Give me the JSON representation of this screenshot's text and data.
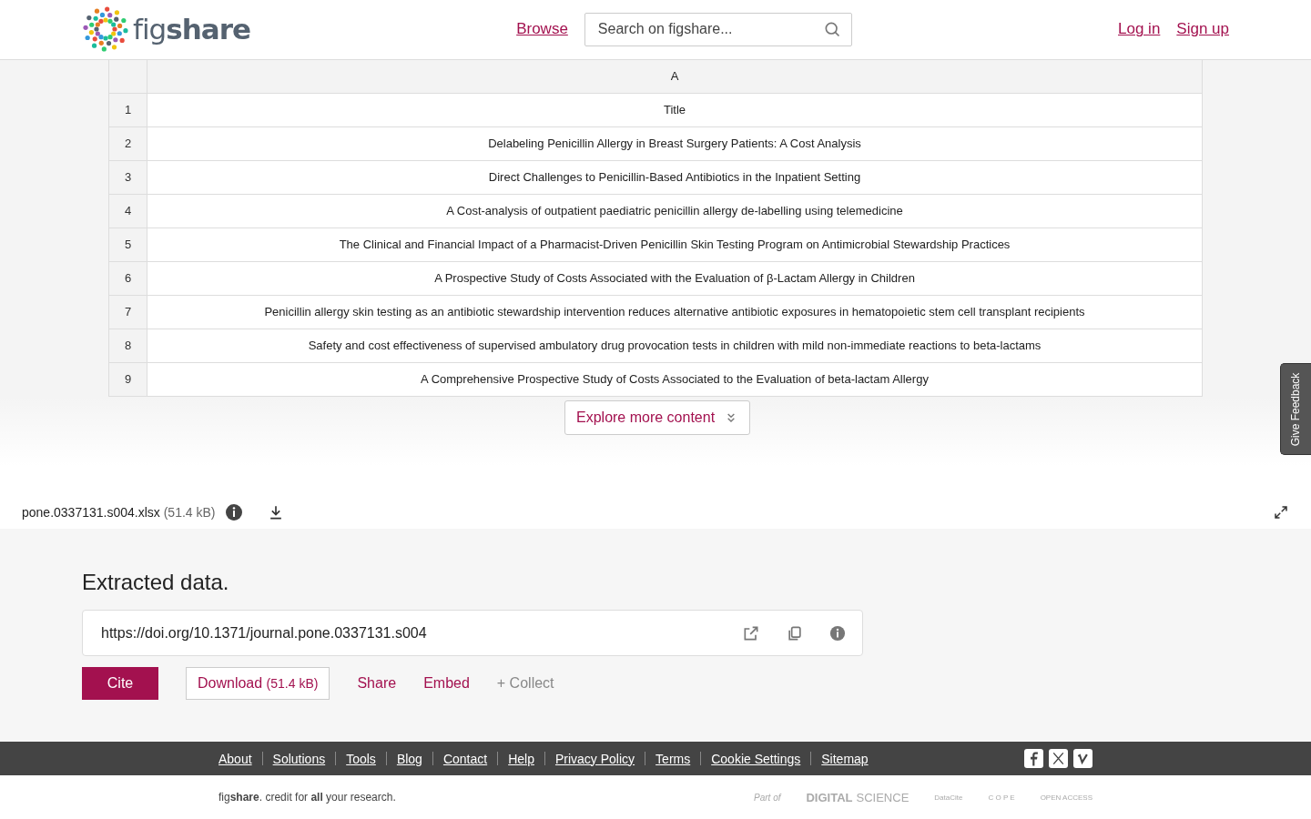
{
  "header": {
    "logo": "fig**share**",
    "nav": [
      {
        "label": "Browse"
      }
    ],
    "search": {
      "placeholder": "Search on figshare..."
    },
    "auth": [
      {
        "label": "Log in"
      },
      {
        "label": "Sign up"
      }
    ]
  },
  "sheet": {
    "column": "A",
    "rows": [
      {
        "number": "1",
        "text": "Title"
      },
      {
        "number": "2",
        "text": "Delabeling Penicillin Allergy in Breast Surgery Patients: A Cost Analysis"
      },
      {
        "number": "3",
        "text": "Direct Challenges to Penicillin-Based Antibiotics in the Inpatient Setting"
      },
      {
        "number": "4",
        "text": "A Cost-analysis of outpatient paediatric penicillin allergy de-labelling using telemedicine"
      },
      {
        "number": "5",
        "text": "The Clinical and Financial Impact of a Pharmacist-Driven Penicillin Skin Testing Program on Antimicrobial Stewardship Practices"
      },
      {
        "number": "6",
        "text": "A Prospective Study of Costs Associated with the Evaluation of β-Lactam Allergy in Children"
      },
      {
        "number": "7",
        "text": "Penicillin allergy skin testing as an antibiotic stewardship intervention reduces alternative antibiotic exposures in hematopoietic stem cell transplant recipients"
      },
      {
        "number": "8",
        "text": "Safety and cost effectiveness of supervised ambulatory drug provocation tests in children with mild non-immediate reactions to beta-lactams"
      },
      {
        "number": "9",
        "text": "A Comprehensive Prospective Study of Costs Associated to the Evaluation of beta-lactam Allergy"
      }
    ],
    "explore": "Explore more content"
  },
  "feedback": "Give Feedback",
  "file": {
    "name": "pone.0337131.s004.xlsx",
    "size": "(51.4 kB)"
  },
  "item": {
    "title": "Extracted data.",
    "doi": "https://doi.org/10.1371/journal.pone.0337131.s004",
    "cite": "Cite",
    "download": "Download",
    "download_size": "(51.4 kB)",
    "actions": [
      {
        "label": "Share"
      },
      {
        "label": "Embed"
      }
    ],
    "collect": "+ Collect"
  },
  "footer": {
    "links": [
      "About",
      "Solutions",
      "Tools",
      "Blog",
      "Contact",
      "Help",
      "Privacy Policy",
      "Terms",
      "Cookie Settings",
      "Sitemap"
    ],
    "tagline": "fig**share**. credit for **all** your research.",
    "partner": "Part of",
    "partner_name": "DIGITAL",
    "partner_name2": "SCIENCE",
    "logos": [
      "DataCite",
      "C O P E",
      "OPEN ACCESS"
    ]
  }
}
